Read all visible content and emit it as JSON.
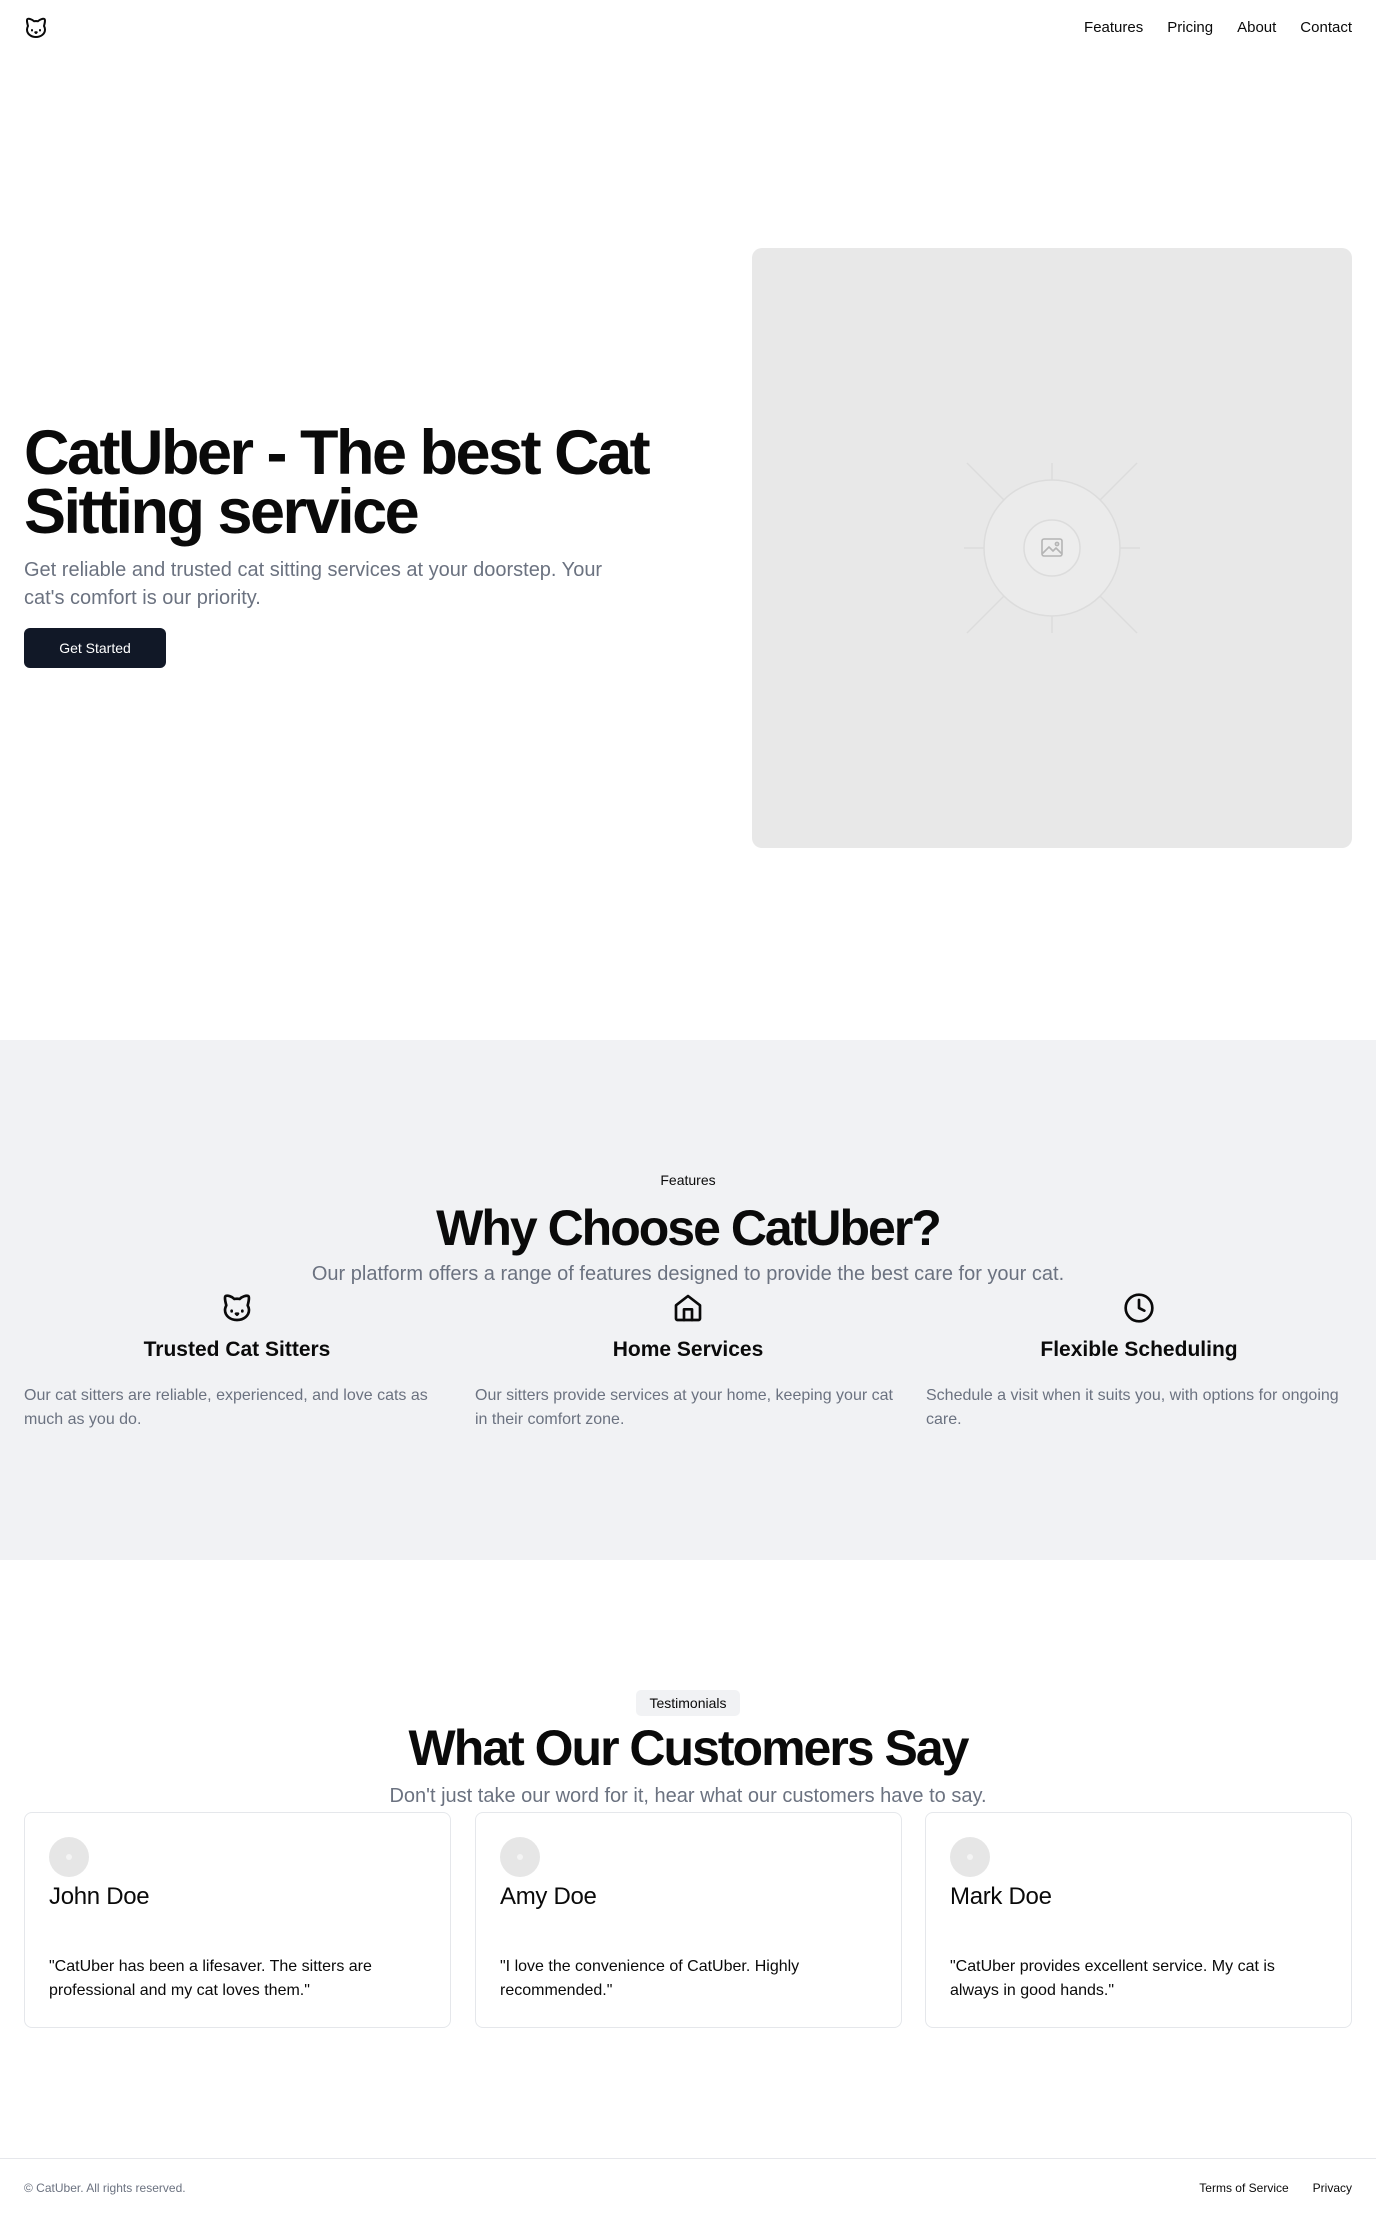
{
  "header": {
    "nav": [
      {
        "label": "Features"
      },
      {
        "label": "Pricing"
      },
      {
        "label": "About"
      },
      {
        "label": "Contact"
      }
    ]
  },
  "hero": {
    "title": "CatUber - The best Cat Sitting service",
    "subtitle": "Get reliable and trusted cat sitting services at your doorstep. Your cat's comfort is our priority.",
    "cta_label": "Get Started"
  },
  "features": {
    "kicker": "Features",
    "title": "Why Choose CatUber?",
    "subtitle": "Our platform offers a range of features designed to provide the best care for your cat.",
    "items": [
      {
        "icon": "cat-icon",
        "title": "Trusted Cat Sitters",
        "text": "Our cat sitters are reliable, experienced, and love cats as much as you do."
      },
      {
        "icon": "home-icon",
        "title": "Home Services",
        "text": "Our sitters provide services at your home, keeping your cat in their comfort zone."
      },
      {
        "icon": "clock-icon",
        "title": "Flexible Scheduling",
        "text": "Schedule a visit when it suits you, with options for ongoing care."
      }
    ]
  },
  "testimonials": {
    "badge": "Testimonials",
    "title": "What Our Customers Say",
    "subtitle": "Don't just take our word for it, hear what our customers have to say.",
    "items": [
      {
        "name": "John Doe",
        "quote": "\"CatUber has been a lifesaver. The sitters are professional and my cat loves them.\""
      },
      {
        "name": "Amy Doe",
        "quote": "\"I love the convenience of CatUber. Highly recommended.\""
      },
      {
        "name": "Mark Doe",
        "quote": "\"CatUber provides excellent service. My cat is always in good hands.\""
      }
    ]
  },
  "footer": {
    "copyright": "© CatUber. All rights reserved.",
    "links": [
      {
        "label": "Terms of Service"
      },
      {
        "label": "Privacy"
      }
    ]
  },
  "colors": {
    "primary": "#111827",
    "muted_text": "#6b7280",
    "section_bg": "#f1f2f4",
    "placeholder_bg": "#e8e8e8"
  }
}
